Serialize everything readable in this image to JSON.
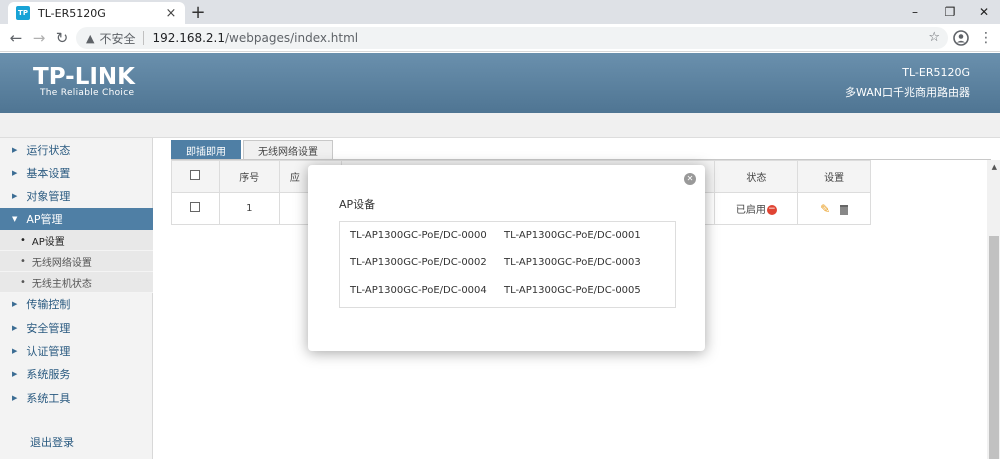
{
  "browser": {
    "tab_title": "TL-ER5120G",
    "favicon_text": "TP",
    "tab_close": "×",
    "new_tab": "+",
    "window_controls": [
      "–",
      "❐",
      "✕"
    ],
    "insecure_label": "不安全",
    "url_host": "192.168.2.1",
    "url_path": "/webpages/index.html"
  },
  "header": {
    "logo_text": "TP-LINK",
    "logo_tagline": "The Reliable Choice",
    "model": "TL-ER5120G",
    "model_desc": "多WAN口千兆商用路由器"
  },
  "sidebar": {
    "items": [
      {
        "label": "运行状态"
      },
      {
        "label": "基本设置"
      },
      {
        "label": "对象管理"
      },
      {
        "label": "AP管理"
      },
      {
        "label": "传输控制"
      },
      {
        "label": "安全管理"
      },
      {
        "label": "认证管理"
      },
      {
        "label": "系统服务"
      },
      {
        "label": "系统工具"
      }
    ],
    "sub_items": [
      {
        "label": "AP设置"
      },
      {
        "label": "无线网络设置"
      },
      {
        "label": "无线主机状态"
      }
    ],
    "logout": "退出登录"
  },
  "content": {
    "tabs": [
      "即插即用",
      "无线网络设置"
    ],
    "columns": [
      "序号",
      "应",
      "状态",
      "设置"
    ],
    "row": {
      "index": "1",
      "status": "已启用"
    }
  },
  "modal": {
    "title": "AP设备",
    "devices": [
      "TL-AP1300GC-PoE/DC-0000",
      "TL-AP1300GC-PoE/DC-0001",
      "TL-AP1300GC-PoE/DC-0002",
      "TL-AP1300GC-PoE/DC-0003",
      "TL-AP1300GC-PoE/DC-0004",
      "TL-AP1300GC-PoE/DC-0005"
    ]
  }
}
